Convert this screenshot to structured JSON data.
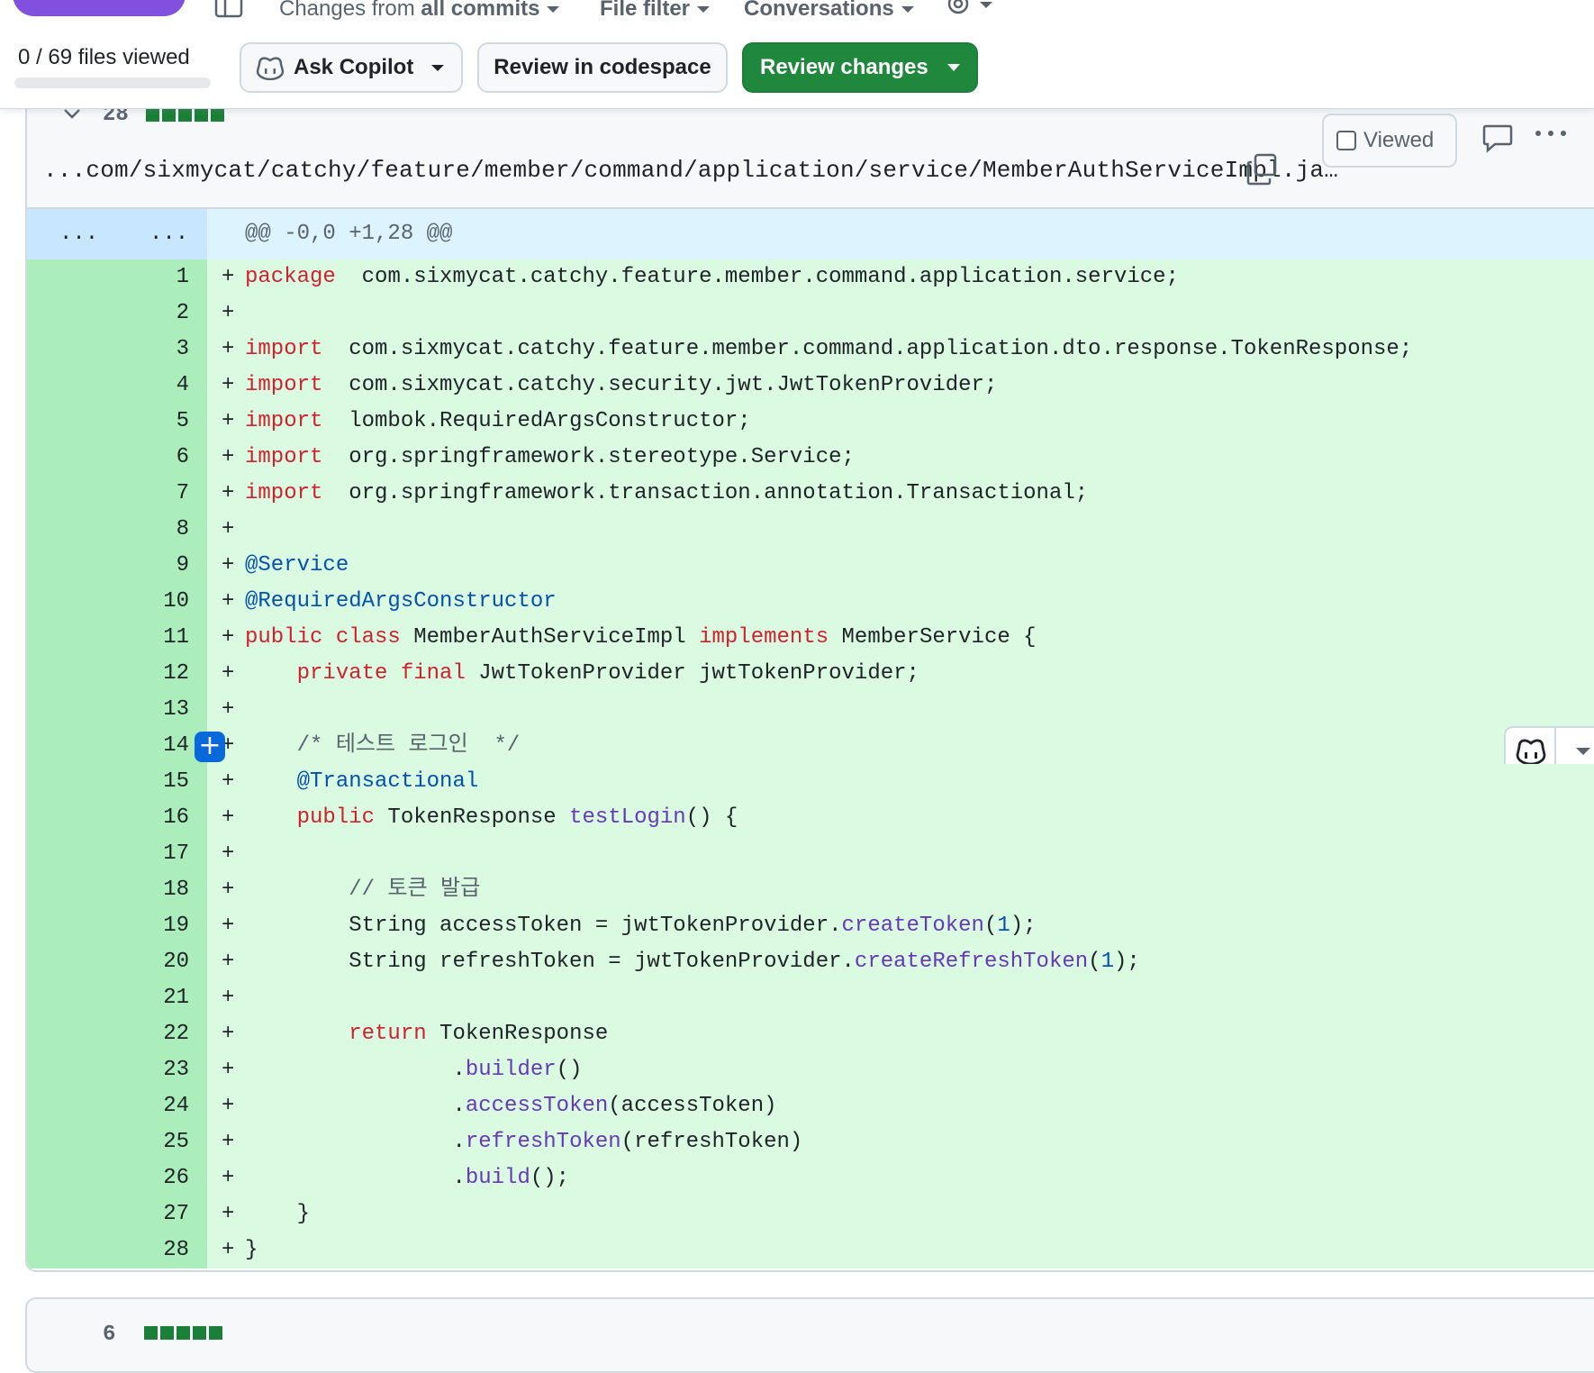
{
  "toolbar": {
    "changes_prefix": "Changes from",
    "changes_value": "all commits",
    "file_filter": "File filter",
    "conversations": "Conversations",
    "files_viewed": "0 / 69 files viewed",
    "ask_copilot": "Ask Copilot",
    "review_codespace": "Review in codespace",
    "review_changes": "Review changes"
  },
  "file": {
    "diffstat_count": "28",
    "path": "...com/sixmycat/catchy/feature/member/command/application/service/MemberAuthServiceImpl.ja…",
    "viewed_label": "Viewed",
    "hunk_expand_old": "...",
    "hunk_expand_new": "...",
    "hunk_header": "@@ -0,0 +1,28 @@",
    "lines": [
      {
        "n": "1",
        "tokens": [
          [
            "kw",
            "package"
          ],
          [
            "",
            "  com.sixmycat.catchy.feature.member.command.application.service;"
          ]
        ]
      },
      {
        "n": "2",
        "tokens": []
      },
      {
        "n": "3",
        "tokens": [
          [
            "kw",
            "import"
          ],
          [
            "",
            "  com.sixmycat.catchy.feature.member.command.application.dto.response.TokenResponse;"
          ]
        ]
      },
      {
        "n": "4",
        "tokens": [
          [
            "kw",
            "import"
          ],
          [
            "",
            "  com.sixmycat.catchy.security.jwt.JwtTokenProvider;"
          ]
        ]
      },
      {
        "n": "5",
        "tokens": [
          [
            "kw",
            "import"
          ],
          [
            "",
            "  lombok.RequiredArgsConstructor;"
          ]
        ]
      },
      {
        "n": "6",
        "tokens": [
          [
            "kw",
            "import"
          ],
          [
            "",
            "  org.springframework.stereotype.Service;"
          ]
        ]
      },
      {
        "n": "7",
        "tokens": [
          [
            "kw",
            "import"
          ],
          [
            "",
            "  org.springframework.transaction.annotation.Transactional;"
          ]
        ]
      },
      {
        "n": "8",
        "tokens": []
      },
      {
        "n": "9",
        "tokens": [
          [
            "an",
            "@Service"
          ]
        ]
      },
      {
        "n": "10",
        "tokens": [
          [
            "an",
            "@RequiredArgsConstructor"
          ]
        ]
      },
      {
        "n": "11",
        "tokens": [
          [
            "kw",
            "public class"
          ],
          [
            "",
            " MemberAuthServiceImpl "
          ],
          [
            "kw",
            "implements"
          ],
          [
            "",
            " MemberService {"
          ]
        ]
      },
      {
        "n": "12",
        "tokens": [
          [
            "",
            "    "
          ],
          [
            "kw",
            "private final"
          ],
          [
            "",
            " JwtTokenProvider jwtTokenProvider;"
          ]
        ]
      },
      {
        "n": "13",
        "tokens": []
      },
      {
        "n": "14",
        "tokens": [
          [
            "",
            "    "
          ],
          [
            "cm",
            "/* 테스트 로그인  */"
          ]
        ]
      },
      {
        "n": "15",
        "tokens": [
          [
            "",
            "    "
          ],
          [
            "an",
            "@Transactional"
          ]
        ]
      },
      {
        "n": "16",
        "tokens": [
          [
            "",
            "    "
          ],
          [
            "kw",
            "public"
          ],
          [
            "",
            " TokenResponse "
          ],
          [
            "fn",
            "testLogin"
          ],
          [
            "",
            "() {"
          ]
        ]
      },
      {
        "n": "17",
        "tokens": []
      },
      {
        "n": "18",
        "tokens": [
          [
            "",
            "        "
          ],
          [
            "cm",
            "// 토큰 발급"
          ]
        ]
      },
      {
        "n": "19",
        "tokens": [
          [
            "",
            "        String accessToken = jwtTokenProvider."
          ],
          [
            "fn",
            "createToken"
          ],
          [
            "",
            "("
          ],
          [
            "nu",
            "1"
          ],
          [
            "",
            ");"
          ]
        ]
      },
      {
        "n": "20",
        "tokens": [
          [
            "",
            "        String refreshToken = jwtTokenProvider."
          ],
          [
            "fn",
            "createRefreshToken"
          ],
          [
            "",
            "("
          ],
          [
            "nu",
            "1"
          ],
          [
            "",
            ");"
          ]
        ]
      },
      {
        "n": "21",
        "tokens": []
      },
      {
        "n": "22",
        "tokens": [
          [
            "",
            "        "
          ],
          [
            "kw",
            "return"
          ],
          [
            "",
            " TokenResponse"
          ]
        ]
      },
      {
        "n": "23",
        "tokens": [
          [
            "",
            "                ."
          ],
          [
            "fn",
            "builder"
          ],
          [
            "",
            "()"
          ]
        ]
      },
      {
        "n": "24",
        "tokens": [
          [
            "",
            "                ."
          ],
          [
            "fn",
            "accessToken"
          ],
          [
            "",
            "(accessToken)"
          ]
        ]
      },
      {
        "n": "25",
        "tokens": [
          [
            "",
            "                ."
          ],
          [
            "fn",
            "refreshToken"
          ],
          [
            "",
            "(refreshToken)"
          ]
        ]
      },
      {
        "n": "26",
        "tokens": [
          [
            "",
            "                ."
          ],
          [
            "fn",
            "build"
          ],
          [
            "",
            "();"
          ]
        ]
      },
      {
        "n": "27",
        "tokens": [
          [
            "",
            "    }"
          ]
        ]
      },
      {
        "n": "28",
        "tokens": [
          [
            "",
            "}"
          ]
        ]
      }
    ]
  },
  "next_file": {
    "diffstat_count": "6"
  },
  "colors": {
    "addition_gutter": "#aceebb",
    "addition_code": "#dafbe1",
    "hunk_bg": "#ddf4ff",
    "primary_green": "#1f883d",
    "keyword": "#cf222e",
    "annotation": "#0550ae",
    "function": "#6639ba"
  },
  "icons": {
    "layout": "sidebar-layout-icon",
    "settings": "gear-icon",
    "copilot": "copilot-icon",
    "copy": "copy-icon",
    "comment": "comment-icon",
    "more": "kebab-horizontal-icon",
    "expand": "chevron-down-icon",
    "add_comment": "plus-icon"
  }
}
